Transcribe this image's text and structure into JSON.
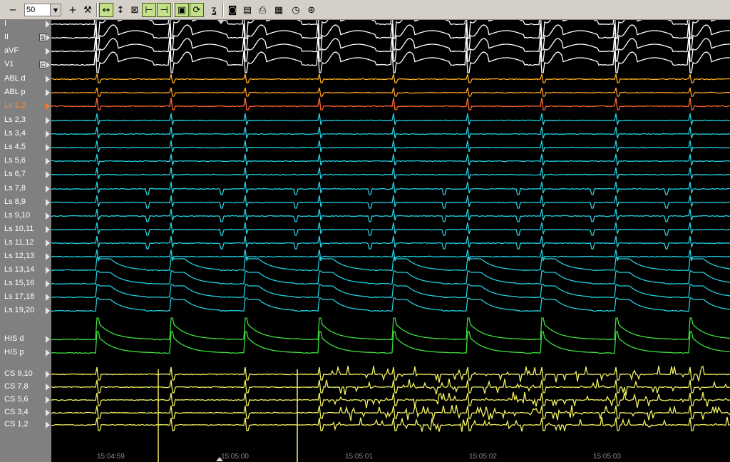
{
  "toolbar": {
    "zoom_value": "50",
    "buttons": [
      {
        "name": "zoom-out",
        "glyph": "−"
      },
      {
        "name": "zoom-in",
        "glyph": "+"
      },
      {
        "name": "tools",
        "glyph": "⚒"
      },
      {
        "name": "fit-horizontal",
        "glyph": "↔"
      },
      {
        "name": "fit-vertical",
        "glyph": "↕"
      },
      {
        "name": "clear",
        "glyph": "⊠"
      },
      {
        "name": "lock-left",
        "glyph": "⊢"
      },
      {
        "name": "lock-right",
        "glyph": "⊣"
      },
      {
        "name": "monitor",
        "glyph": "▣"
      },
      {
        "name": "refresh",
        "glyph": "⟳"
      },
      {
        "name": "wave-select",
        "glyph": "ʓ"
      },
      {
        "name": "camera",
        "glyph": "◙"
      },
      {
        "name": "print-preview",
        "glyph": "▤"
      },
      {
        "name": "print",
        "glyph": "⎙"
      },
      {
        "name": "table",
        "glyph": "▦"
      },
      {
        "name": "clock",
        "glyph": "◷"
      },
      {
        "name": "timer",
        "glyph": "⊛"
      }
    ]
  },
  "channels": [
    {
      "label": "I",
      "color": "#ffffff",
      "badge": ""
    },
    {
      "label": "II",
      "color": "#ffffff",
      "badge": "S"
    },
    {
      "label": "aVF",
      "color": "#ffffff",
      "badge": ""
    },
    {
      "label": "V1",
      "color": "#ffffff",
      "badge": "C"
    },
    {
      "label": "ABL d",
      "color": "#ffb020",
      "badge": ""
    },
    {
      "label": "ABL p",
      "color": "#ffa020",
      "badge": ""
    },
    {
      "label": "Ls 1,2",
      "color": "#ff6a30",
      "badge": "",
      "selected": true
    },
    {
      "label": "Ls 2,3",
      "color": "#22d0e0",
      "badge": ""
    },
    {
      "label": "Ls 3,4",
      "color": "#22d0e0",
      "badge": ""
    },
    {
      "label": "Ls 4,5",
      "color": "#22d0e0",
      "badge": ""
    },
    {
      "label": "Ls 5,6",
      "color": "#22d0e0",
      "badge": ""
    },
    {
      "label": "Ls 6,7",
      "color": "#22d0e0",
      "badge": ""
    },
    {
      "label": "Ls 7,8",
      "color": "#22d0e0",
      "badge": ""
    },
    {
      "label": "Ls 8,9",
      "color": "#22d0e0",
      "badge": ""
    },
    {
      "label": "Ls 9,10",
      "color": "#22d0e0",
      "badge": ""
    },
    {
      "label": "Ls 10,11",
      "color": "#22d0e0",
      "badge": ""
    },
    {
      "label": "Ls 11,12",
      "color": "#22d0e0",
      "badge": ""
    },
    {
      "label": "Ls 12,13",
      "color": "#22d0e0",
      "badge": ""
    },
    {
      "label": "Ls 13,14",
      "color": "#22d0e0",
      "badge": ""
    },
    {
      "label": "Ls 15,16",
      "color": "#22d0e0",
      "badge": ""
    },
    {
      "label": "Ls 17,18",
      "color": "#22d0e0",
      "badge": ""
    },
    {
      "label": "Ls 19,20",
      "color": "#22d0e0",
      "badge": ""
    },
    {
      "label": "HIS d",
      "color": "#3ee03e",
      "badge": ""
    },
    {
      "label": "HIS p",
      "color": "#3ee03e",
      "badge": ""
    },
    {
      "label": "CS 9,10",
      "color": "#f2f060",
      "badge": ""
    },
    {
      "label": "CS 7,8",
      "color": "#f2f060",
      "badge": ""
    },
    {
      "label": "CS 5,6",
      "color": "#f2f060",
      "badge": ""
    },
    {
      "label": "CS 3,4",
      "color": "#f2f060",
      "badge": ""
    },
    {
      "label": "CS 1,2",
      "color": "#f2f060",
      "badge": ""
    }
  ],
  "time_axis": {
    "labels": [
      "15:04:59",
      "15:05:00",
      "15:05:01",
      "15:05:02",
      "15:05:03"
    ]
  },
  "colors": {
    "background": "#000000",
    "sidebar": "#808080",
    "toolbar": "#d4d0c8",
    "toolbar_active": "#c4e08a"
  }
}
